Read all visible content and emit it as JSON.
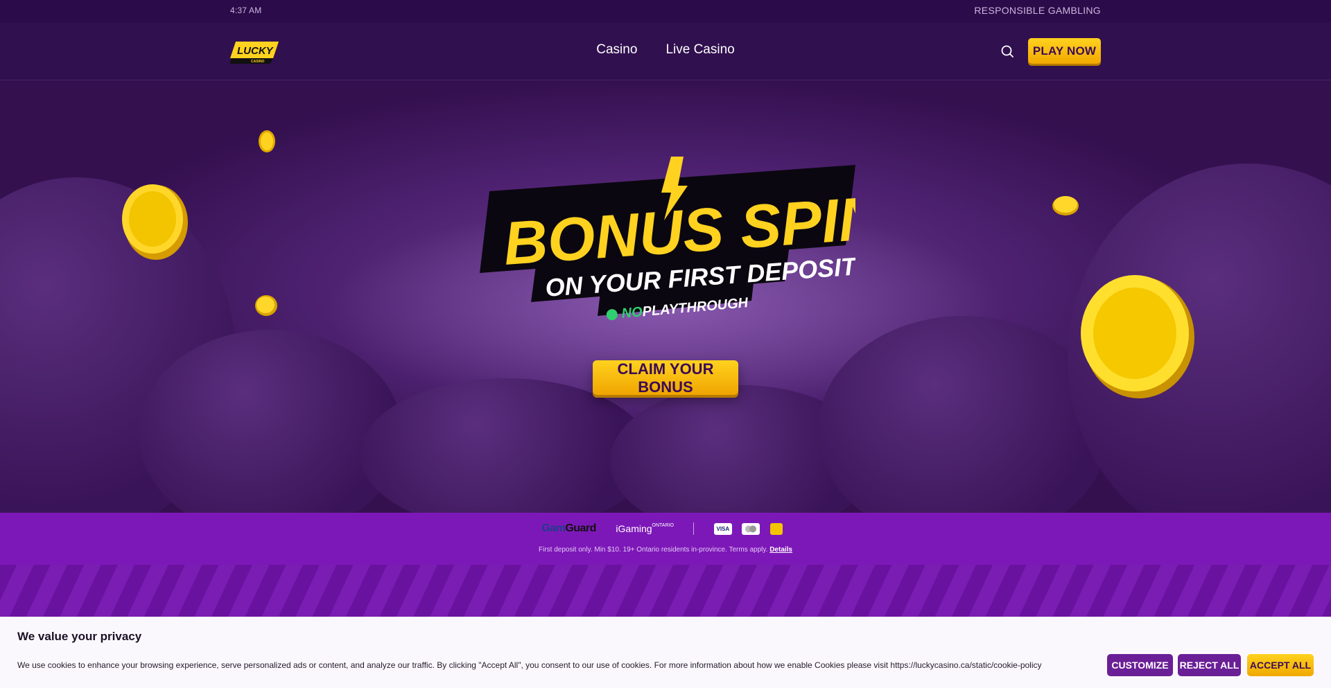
{
  "topbar": {
    "time": "4:37 AM",
    "responsible_gambling": "RESPONSIBLE GAMBLING"
  },
  "header": {
    "logo_text": "LUCKY",
    "logo_subtext": "CASINO",
    "nav": [
      "Casino",
      "Live Casino"
    ],
    "play_now_label": "PLAY NOW",
    "search_icon": "search-icon"
  },
  "hero": {
    "headline": "BONUS SPINS",
    "subheadline": "ON YOUR FIRST DEPOSIT!",
    "no_label": "NO",
    "playthrough_label": "PLAYTHROUGH",
    "cta_label": "CLAIM YOUR BONUS"
  },
  "trust": {
    "gamguard_part1": "Gam",
    "gamguard_part2": "Guard",
    "igaming_label": "iGaming",
    "igaming_super": "ONTARIO",
    "payments": [
      "VISA",
      "MC",
      "INTERAC"
    ],
    "disclaimer": "First deposit only. Min $10. 19+ Ontario residents in-province. Terms apply.",
    "details_link": "Details"
  },
  "cookie": {
    "title": "We value your privacy",
    "text": "We use cookies to enhance your browsing experience, serve personalized ads or content, and analyze our traffic. By clicking \"Accept All\", you consent to our use of cookies. For more information about how we enable Cookies please visit https://luckycasino.ca/static/cookie-policy",
    "customize_label": "CUSTOMIZE",
    "reject_label": "REJECT ALL",
    "accept_label": "ACCEPT ALL"
  },
  "colors": {
    "accent_yellow": "#ffd21f",
    "brand_purple": "#31104f",
    "trust_purple": "#7d18b8",
    "button_purple": "#6a1f96"
  }
}
